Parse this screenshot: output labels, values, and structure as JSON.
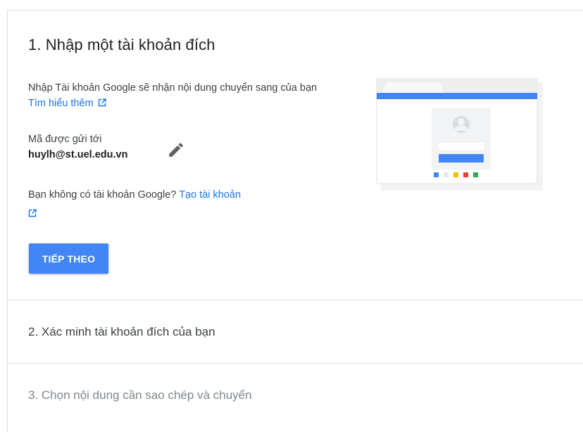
{
  "step1": {
    "title": "1. Nhập một tài khoản đích",
    "description": "Nhập Tài khoản Google sẽ nhận nội dung chuyển sang của bạn ",
    "learn_more_link": "Tìm hiểu thêm",
    "sent_to_label": "Mã được gửi tới",
    "sent_to_email": "huylh@st.uel.edu.vn",
    "no_account_text": "Bạn không có tài khoản Google? ",
    "create_account_link": "Tạo tài khoản",
    "next_button": "TIẾP THEO"
  },
  "step2": {
    "title": "2. Xác minh tài khoản đích của bạn"
  },
  "step3": {
    "title": "3. Chọn nội dung cần sao chép và chuyển"
  },
  "colors": {
    "accent": "#4285f4",
    "link": "#1a73e8",
    "google_dots": [
      "#4285f4",
      "#e8eaed",
      "#fbbc04",
      "#ea4335",
      "#34a853"
    ]
  },
  "icons": {
    "external_link": "external-link-icon",
    "edit": "pencil-icon"
  }
}
